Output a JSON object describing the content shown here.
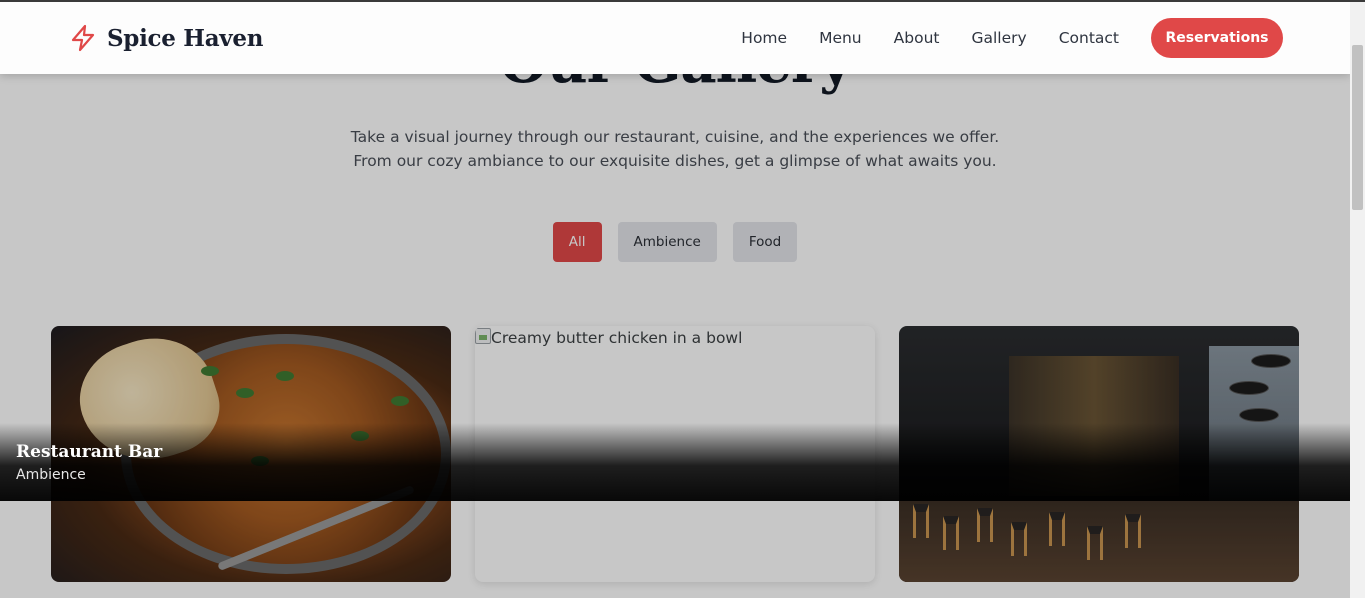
{
  "header": {
    "brand": "Spice Haven",
    "nav": [
      "Home",
      "Menu",
      "About",
      "Gallery",
      "Contact"
    ],
    "reservations_label": "Reservations"
  },
  "gallery": {
    "title": "Our Gallery",
    "subtitle_line1": "Take a visual journey through our restaurant, cuisine, and the experiences we offer.",
    "subtitle_line2": "From our cozy ambiance to our exquisite dishes, get a glimpse of what awaits you.",
    "filters": [
      "All",
      "Ambience",
      "Food"
    ],
    "active_filter": "All",
    "broken_image_alt": "Creamy butter chicken in a bowl"
  },
  "lightbox": {
    "title": "Restaurant Bar",
    "category": "Ambience"
  },
  "colors": {
    "accent": "#e04848",
    "dark_text": "#1a2030"
  }
}
